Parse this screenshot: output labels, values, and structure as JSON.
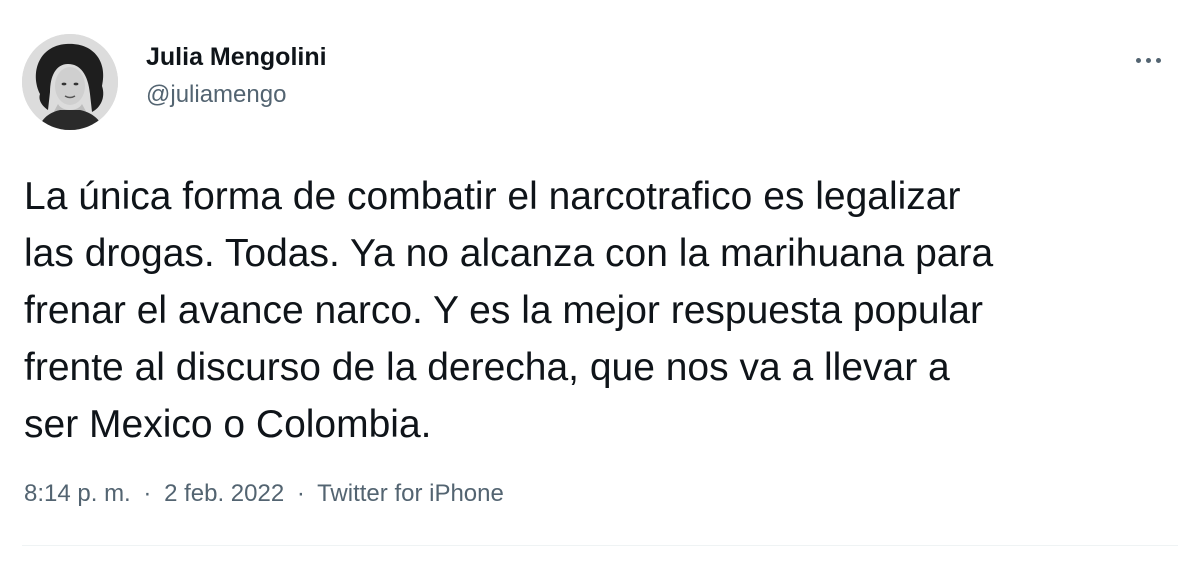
{
  "author": {
    "display_name": "Julia Mengolini",
    "handle": "@juliamengo",
    "avatar_icon": "profile-photo"
  },
  "menu": {
    "icon": "more-options-icon"
  },
  "tweet": {
    "text": "La única forma de combatir el narcotrafico es legalizar\nlas drogas. Todas. Ya no alcanza con la marihuana para\nfrenar el avance narco. Y es la mejor respuesta popular\nfrente al discurso de la derecha, que nos va a llevar a\nser Mexico o Colombia."
  },
  "meta": {
    "time": "8:14 p. m.",
    "separator": "·",
    "date": "2 feb. 2022",
    "source": "Twitter for iPhone"
  },
  "colors": {
    "text": "#0f1419",
    "secondary": "#536471",
    "divider": "#eff3f4"
  }
}
